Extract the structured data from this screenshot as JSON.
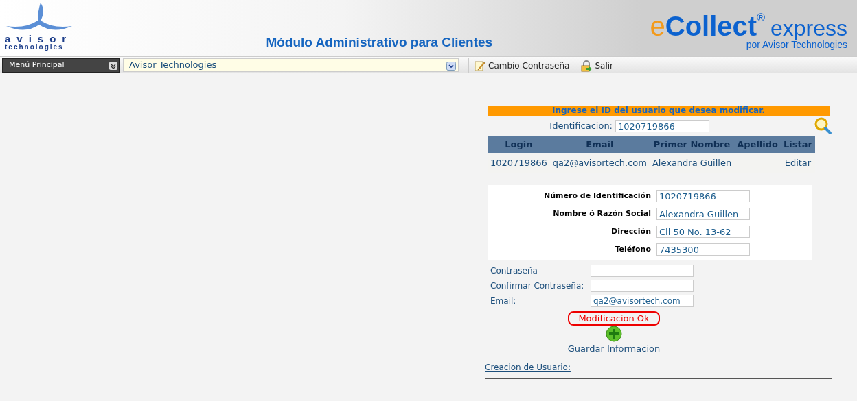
{
  "header": {
    "logo_top": "avisor",
    "logo_bottom": "technologies",
    "title": "Módulo Administrativo para Clientes",
    "brand_e": "e",
    "brand_main": "Collect",
    "brand_reg": "®",
    "brand_suffix": "express",
    "brand_by": "por Avisor Technologies"
  },
  "toolbar": {
    "menu": "Menú Principal",
    "client_select": "Avisor Technologies",
    "actions": [
      {
        "kind": "password",
        "label": "Cambio Contraseña"
      },
      {
        "kind": "exit",
        "label": "Salir"
      }
    ]
  },
  "search": {
    "banner": "Ingrese el ID del usuario que desea modificar.",
    "label": "Identificacion:",
    "value": "1020719866"
  },
  "results": {
    "columns": [
      "Login",
      "Email",
      "Primer Nombre",
      "Apellido",
      "Listar"
    ],
    "rows": [
      {
        "login": "1020719866",
        "email": "qa2@avisortech.com",
        "first_name": "Alexandra Guillen",
        "action": "Editar"
      }
    ]
  },
  "details": [
    {
      "label": "Número de Identificación",
      "value": "1020719866"
    },
    {
      "label": "Nombre ó Razón Social",
      "value": "Alexandra Guillen"
    },
    {
      "label": "Dirección",
      "value": "Cll 50 No. 13-62"
    },
    {
      "label": "Teléfono",
      "value": "7435300"
    }
  ],
  "account": [
    {
      "label": "Contraseña"
    },
    {
      "label": "Confirmar Contraseña:"
    },
    {
      "label": "Email:",
      "value": "qa2@avisortech.com"
    }
  ],
  "message": "Modificacion Ok",
  "save": "Guardar Informacion",
  "create_link": "Creacion de Usuario:"
}
